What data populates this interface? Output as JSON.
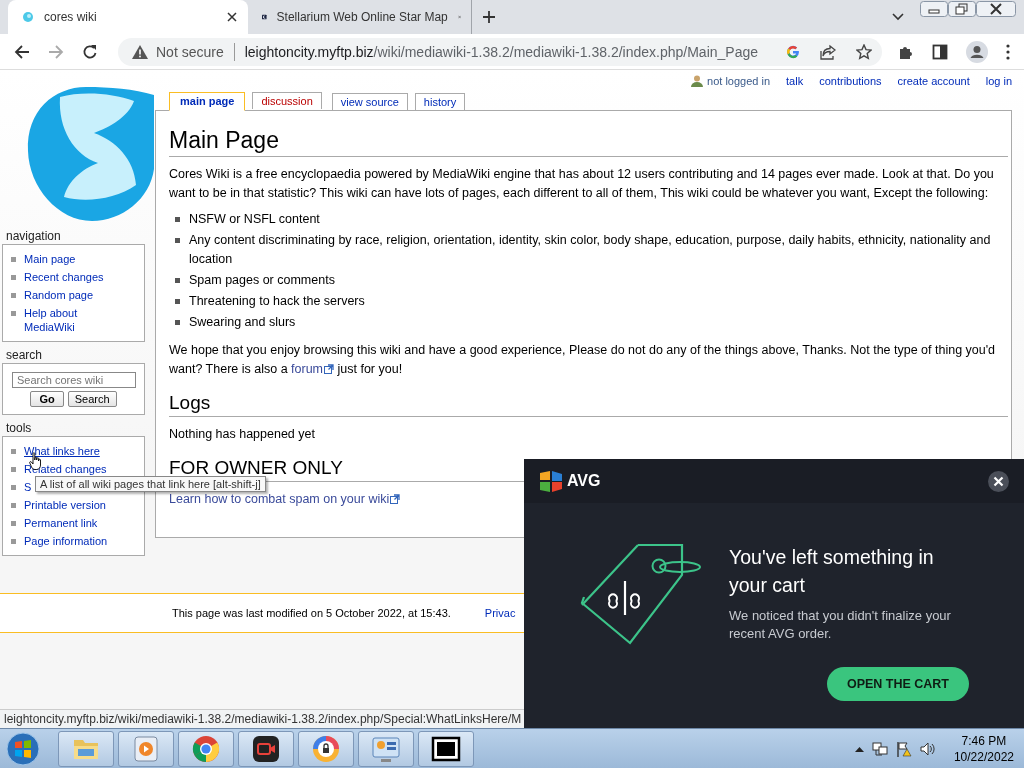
{
  "browser": {
    "tabs": [
      {
        "title": "cores wiki",
        "selected": true,
        "kind": "wiki"
      },
      {
        "title": "Stellarium Web Online Star Map",
        "selected": false,
        "kind": "stars"
      }
    ],
    "address": {
      "security": "Not secure",
      "host": "leightoncity.myftp.biz",
      "path": "/wiki/mediawiki-1.38.2/mediawiki-1.38.2/index.php/Main_Page"
    }
  },
  "personal_tools": [
    "not logged in",
    "talk",
    "contributions",
    "create account",
    "log in"
  ],
  "namespace_tabs": [
    {
      "label": "main page",
      "selected": true,
      "missing": false
    },
    {
      "label": "discussion",
      "selected": false,
      "missing": true
    }
  ],
  "action_tabs": [
    {
      "label": "view source",
      "selected": false,
      "missing": false
    },
    {
      "label": "history",
      "selected": false,
      "missing": false
    }
  ],
  "sidebar": [
    {
      "kind": "links",
      "title": "navigation",
      "items": [
        "Main page",
        "Recent changes",
        "Random page",
        "Help about MediaWiki"
      ]
    },
    {
      "kind": "search",
      "title": "search",
      "placeholder": "Search cores wiki",
      "buttons": [
        "Go",
        "Search"
      ]
    },
    {
      "kind": "links",
      "title": "tools",
      "items": [
        "What links here",
        "Related changes",
        "S",
        "Printable version",
        "Permanent link",
        "Page information"
      ]
    }
  ],
  "content": {
    "title": "Main Page",
    "intro": "Cores Wiki is a free encyclopaedia powered by MediaWiki engine that has about 12 users contributing and 14 pages ever made. Look at that. Do you want to be in that statistic? This wiki can have lots of pages, each different to all of them, This wiki could be whatever you want, Except the following:",
    "rules": [
      "NSFW or NSFL content",
      "Any content discriminating by race, religion, orientation, identity, skin color, body shape, education, purpose, daily habits, ethnicity, nationality and location",
      "Spam pages or comments",
      "Threatening to hack the servers",
      "Swearing and slurs"
    ],
    "closing": {
      "before": "We hope that you enjoy browsing this wiki and have a good experience, Please do not do any of the things above, Thanks. Not the type of thing you'd want? There is also a ",
      "link": "forum",
      "after": " just for you!"
    },
    "sections": [
      {
        "heading": "Logs",
        "kind": "text",
        "text": "Nothing has happened yet"
      },
      {
        "heading": "FOR OWNER ONLY",
        "kind": "link",
        "text": "Learn how to combat spam on your wiki"
      }
    ]
  },
  "footer": [
    "This page was last modified on 5 October 2022, at 15:43.",
    "Privac"
  ],
  "tooltip": "A list of all wiki pages that link here [alt-shift-j]",
  "status_url": "leightoncity.myftp.biz/wiki/mediawiki-1.38.2/mediawiki-1.38.2/index.php/Special:WhatLinksHere/M",
  "popup": {
    "brand": "AVG",
    "title": "You've left something in your cart",
    "text": "We noticed that you didn't finalize your recent AVG order.",
    "button": "OPEN THE CART"
  },
  "taskbar": {
    "time": "7:46 PM",
    "date": "10/22/2022"
  }
}
